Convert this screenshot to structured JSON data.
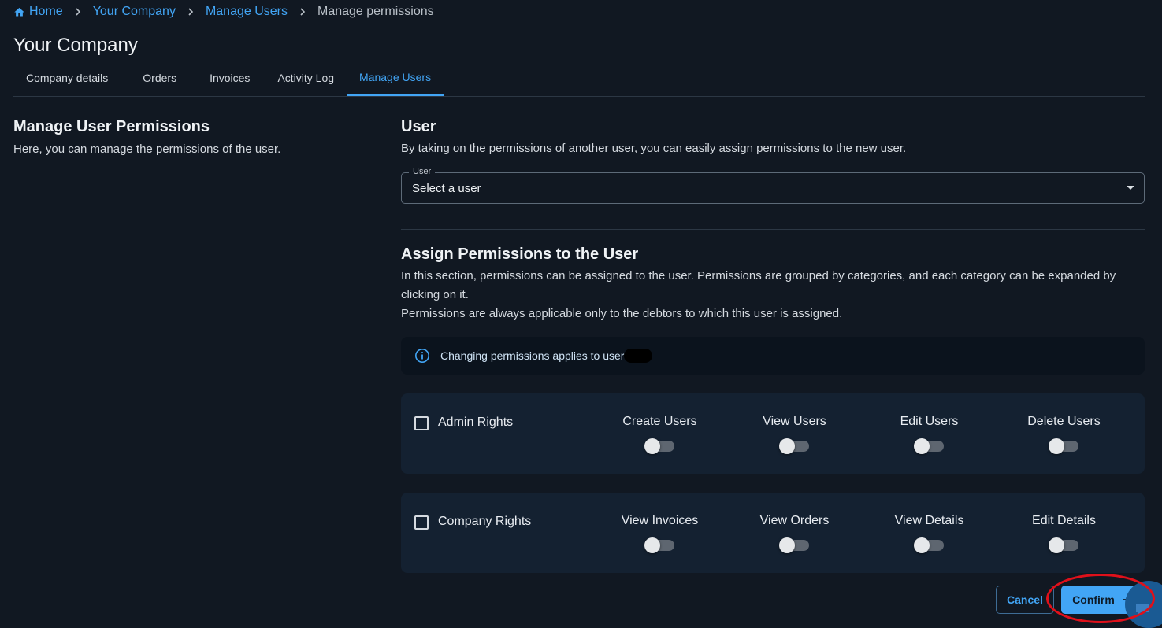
{
  "breadcrumb": {
    "home": "Home",
    "company": "Your Company",
    "manage_users": "Manage Users",
    "current": "Manage permissions"
  },
  "page_title": "Your Company",
  "tabs": [
    {
      "label": "Company details"
    },
    {
      "label": "Orders"
    },
    {
      "label": "Invoices"
    },
    {
      "label": "Activity Log"
    },
    {
      "label": "Manage Users"
    }
  ],
  "left": {
    "title": "Manage User Permissions",
    "description": "Here, you can manage the permissions of the user."
  },
  "user_section": {
    "title": "User",
    "description": "By taking on the permissions of another user, you can easily assign permissions to the new user.",
    "select_label": "User",
    "select_value": "Select a user"
  },
  "assign_section": {
    "title": "Assign Permissions to the User",
    "description_1": "In this section, permissions can be assigned to the user. Permissions are grouped by categories, and each category can be expanded by clicking on it.",
    "description_2": "Permissions are always applicable only to the debtors to which this user is assigned."
  },
  "info": {
    "text": "Changing permissions applies to user"
  },
  "permission_groups": [
    {
      "label": "Admin Rights",
      "checked": false,
      "permissions": [
        {
          "name": "Create Users",
          "enabled": false
        },
        {
          "name": "View Users",
          "enabled": false
        },
        {
          "name": "Edit Users",
          "enabled": false
        },
        {
          "name": "Delete Users",
          "enabled": false
        }
      ]
    },
    {
      "label": "Company Rights",
      "checked": false,
      "permissions": [
        {
          "name": "View Invoices",
          "enabled": false
        },
        {
          "name": "View Orders",
          "enabled": false
        },
        {
          "name": "View Details",
          "enabled": false
        },
        {
          "name": "Edit Details",
          "enabled": false
        }
      ]
    }
  ],
  "buttons": {
    "cancel": "Cancel",
    "confirm": "Confirm"
  },
  "colors": {
    "background": "#111822",
    "accent": "#42a5f5",
    "card": "#142131",
    "highlight": "#e0101a"
  }
}
